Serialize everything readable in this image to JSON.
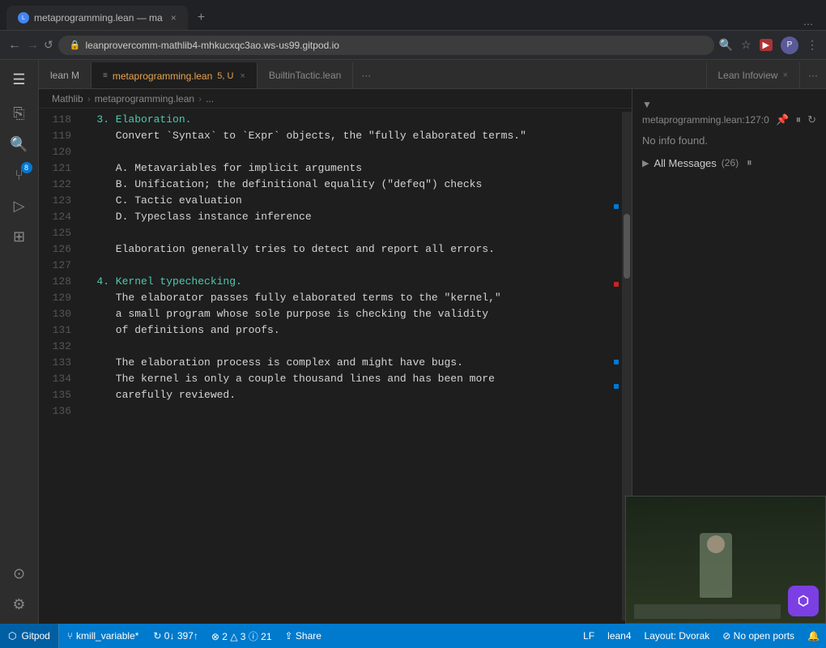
{
  "browser": {
    "tab_active_label": "metaprogramming.lean — ma",
    "tab_favicon": "◉",
    "url": "leanprovercomm-mathlib4-mhkucxqc3ao.ws-us99.gitpod.io",
    "new_tab_label": "+",
    "tab_close": "×"
  },
  "editor": {
    "menu_icon": "☰",
    "tabs": [
      {
        "label": "lean M",
        "active": false,
        "modified": false,
        "closeable": false
      },
      {
        "label": "metaprogramming.lean",
        "badge": "5, U",
        "active": true,
        "modified": true,
        "closeable": true
      },
      {
        "label": "BuiltinTactic.lean",
        "active": false,
        "modified": false,
        "closeable": false
      }
    ],
    "tab_extra": "···",
    "breadcrumb": [
      "Mathlib",
      "metaprogramming.lean",
      "..."
    ],
    "code_lines": [
      {
        "num": "118",
        "text": "   3. Elaboration.",
        "cls": "c-heading"
      },
      {
        "num": "119",
        "text": "      Convert `Syntax` to `Expr` objects, the \"fully elaborated terms.\"",
        "cls": "c-white"
      },
      {
        "num": "120",
        "text": "",
        "cls": ""
      },
      {
        "num": "121",
        "text": "      A. Metavariables for implicit arguments",
        "cls": "c-white"
      },
      {
        "num": "122",
        "text": "      B. Unification; the definitional equality (\"defeq\") checks",
        "cls": "c-white"
      },
      {
        "num": "123",
        "text": "      C. Tactic evaluation",
        "cls": "c-white"
      },
      {
        "num": "124",
        "text": "      D. Typeclass instance inference",
        "cls": "c-white"
      },
      {
        "num": "125",
        "text": "",
        "cls": ""
      },
      {
        "num": "126",
        "text": "      Elaboration generally tries to detect and report all errors.",
        "cls": "c-white"
      },
      {
        "num": "127",
        "text": "",
        "cls": ""
      },
      {
        "num": "128",
        "text": "   4. Kernel typechecking.",
        "cls": "c-heading"
      },
      {
        "num": "129",
        "text": "      The elaborator passes fully elaborated terms to the \"kernel,\"",
        "cls": "c-white"
      },
      {
        "num": "130",
        "text": "      a small program whose sole purpose is checking the validity",
        "cls": "c-white"
      },
      {
        "num": "131",
        "text": "      of definitions and proofs.",
        "cls": "c-white"
      },
      {
        "num": "132",
        "text": "",
        "cls": ""
      },
      {
        "num": "133",
        "text": "      The elaboration process is complex and might have bugs.",
        "cls": "c-white"
      },
      {
        "num": "134",
        "text": "      The kernel is only a couple thousand lines and has been more",
        "cls": "c-white"
      },
      {
        "num": "135",
        "text": "      carefully reviewed.",
        "cls": "c-white"
      },
      {
        "num": "136",
        "text": "",
        "cls": ""
      }
    ]
  },
  "infoview": {
    "panel_label": "Lean Infoview",
    "panel_close": "×",
    "panel_dots": "···",
    "location": "metaprogramming.lean:127:0",
    "no_info_text": "No info found.",
    "all_messages_label": "All Messages",
    "message_count": "(26)",
    "triangle": "▼"
  },
  "activity_bar": {
    "icons": [
      {
        "name": "files-icon",
        "symbol": "⎘",
        "active": false
      },
      {
        "name": "search-icon",
        "symbol": "⌕",
        "active": false
      },
      {
        "name": "source-control-icon",
        "symbol": "⑂",
        "active": false,
        "badge": "8"
      },
      {
        "name": "run-icon",
        "symbol": "▷",
        "active": false
      },
      {
        "name": "extensions-icon",
        "symbol": "⊞",
        "active": false
      },
      {
        "name": "account-icon",
        "symbol": "⊙",
        "active": false
      },
      {
        "name": "settings-icon",
        "symbol": "⚙",
        "active": false
      }
    ]
  },
  "status_bar": {
    "gitpod_label": "Gitpod",
    "branch": "kmill_variable*",
    "sync": "↻ 0↓ 397↑",
    "errors": "⊗ 2 △ 3 ⓘ 21",
    "share": "⇪ Share",
    "encoding": "LF",
    "language": "lean4",
    "layout": "Layout: Dvorak",
    "ports": "⊘ No open ports"
  }
}
